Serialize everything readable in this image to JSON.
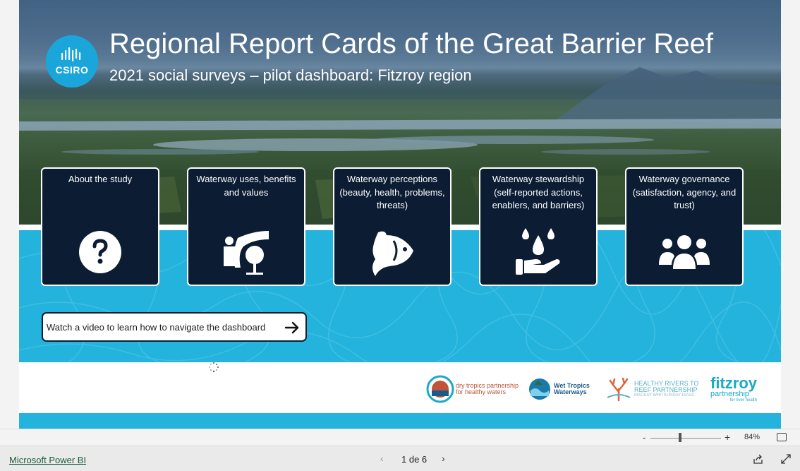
{
  "report": {
    "title": "Regional Report Cards of the Great Barrier Reef",
    "subtitle": "2021 social surveys – pilot dashboard: Fitzroy region",
    "logo_text": "CSIRO"
  },
  "cards": [
    {
      "label": "About the study",
      "icon": "question-circle-icon"
    },
    {
      "label": "Waterway uses, benefits and values",
      "icon": "landscape-river-tree-icon"
    },
    {
      "label": "Waterway perceptions (beauty, health, problems, threats)",
      "icon": "fish-icon"
    },
    {
      "label": "Waterway stewardship (self-reported actions, enablers, and barriers)",
      "icon": "hand-water-drops-icon"
    },
    {
      "label": "Waterway governance (satisfaction, agency, and trust)",
      "icon": "people-group-icon"
    }
  ],
  "video_button": {
    "label": "Watch a video to learn how to navigate the dashboard",
    "icon": "arrow-right-icon"
  },
  "partners": [
    {
      "line1": "dry tropics partnership",
      "line2": "for healthy waters",
      "color": "#c0553a"
    },
    {
      "line1": "Wet Tropics",
      "line2": "Waterways",
      "color": "#1a5a8a"
    },
    {
      "line1": "HEALTHY RIVERS TO",
      "line2": "REEF PARTNERSHIP",
      "line3": "MACKAY-WHITSUNDAY-ISAAC",
      "color": "#5ab0c8"
    },
    {
      "line1": "fitzroy",
      "line2": "partnership",
      "line3": "for river health",
      "color": "#1aa9c9"
    }
  ],
  "status": {
    "zoom_minus": "-",
    "zoom_plus": "+",
    "zoom_value": "84%",
    "zoom_level": 0.42
  },
  "bottom": {
    "product_link": "Microsoft Power BI",
    "page_indicator": "1 de 6",
    "prev": "‹",
    "next": "›"
  },
  "colors": {
    "accent_cyan": "#23b3dc",
    "card_navy": "#0b1c33",
    "logo_blue": "#1aa6da"
  }
}
